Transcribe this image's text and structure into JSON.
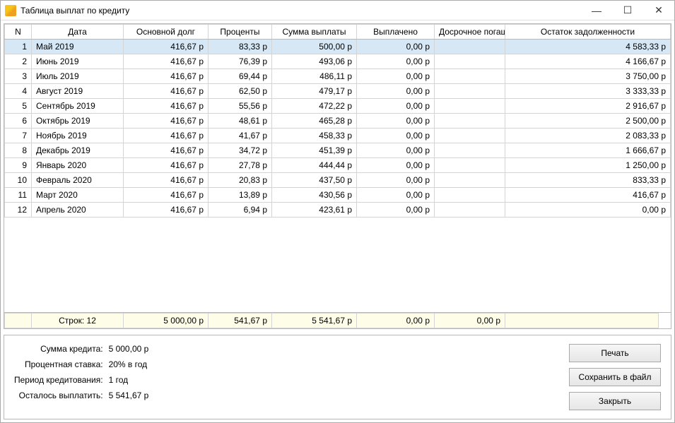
{
  "window": {
    "title": "Таблица выплат по кредиту"
  },
  "table": {
    "headers": {
      "n": "N",
      "date": "Дата",
      "principal": "Основной долг",
      "interest": "Проценты",
      "payment": "Сумма выплаты",
      "paid": "Выплачено",
      "early": "Досрочное погашение",
      "balance": "Остаток задолженности"
    },
    "rows": [
      {
        "n": "1",
        "date": "Май 2019",
        "principal": "416,67 р",
        "interest": "83,33 р",
        "payment": "500,00 р",
        "paid": "0,00 р",
        "early": "",
        "balance": "4 583,33 р"
      },
      {
        "n": "2",
        "date": "Июнь 2019",
        "principal": "416,67 р",
        "interest": "76,39 р",
        "payment": "493,06 р",
        "paid": "0,00 р",
        "early": "",
        "balance": "4 166,67 р"
      },
      {
        "n": "3",
        "date": "Июль 2019",
        "principal": "416,67 р",
        "interest": "69,44 р",
        "payment": "486,11 р",
        "paid": "0,00 р",
        "early": "",
        "balance": "3 750,00 р"
      },
      {
        "n": "4",
        "date": "Август 2019",
        "principal": "416,67 р",
        "interest": "62,50 р",
        "payment": "479,17 р",
        "paid": "0,00 р",
        "early": "",
        "balance": "3 333,33 р"
      },
      {
        "n": "5",
        "date": "Сентябрь 2019",
        "principal": "416,67 р",
        "interest": "55,56 р",
        "payment": "472,22 р",
        "paid": "0,00 р",
        "early": "",
        "balance": "2 916,67 р"
      },
      {
        "n": "6",
        "date": "Октябрь 2019",
        "principal": "416,67 р",
        "interest": "48,61 р",
        "payment": "465,28 р",
        "paid": "0,00 р",
        "early": "",
        "balance": "2 500,00 р"
      },
      {
        "n": "7",
        "date": "Ноябрь 2019",
        "principal": "416,67 р",
        "interest": "41,67 р",
        "payment": "458,33 р",
        "paid": "0,00 р",
        "early": "",
        "balance": "2 083,33 р"
      },
      {
        "n": "8",
        "date": "Декабрь 2019",
        "principal": "416,67 р",
        "interest": "34,72 р",
        "payment": "451,39 р",
        "paid": "0,00 р",
        "early": "",
        "balance": "1 666,67 р"
      },
      {
        "n": "9",
        "date": "Январь 2020",
        "principal": "416,67 р",
        "interest": "27,78 р",
        "payment": "444,44 р",
        "paid": "0,00 р",
        "early": "",
        "balance": "1 250,00 р"
      },
      {
        "n": "10",
        "date": "Февраль 2020",
        "principal": "416,67 р",
        "interest": "20,83 р",
        "payment": "437,50 р",
        "paid": "0,00 р",
        "early": "",
        "balance": "833,33 р"
      },
      {
        "n": "11",
        "date": "Март 2020",
        "principal": "416,67 р",
        "interest": "13,89 р",
        "payment": "430,56 р",
        "paid": "0,00 р",
        "early": "",
        "balance": "416,67 р"
      },
      {
        "n": "12",
        "date": "Апрель 2020",
        "principal": "416,67 р",
        "interest": "6,94 р",
        "payment": "423,61 р",
        "paid": "0,00 р",
        "early": "",
        "balance": "0,00 р"
      }
    ],
    "footer": {
      "rows_label": "Строк: 12",
      "principal_total": "5 000,00 р",
      "interest_total": "541,67 р",
      "payment_total": "5 541,67 р",
      "paid_total": "0,00 р",
      "early_total": "0,00 р",
      "balance_total": ""
    }
  },
  "summary": {
    "amount_label": "Сумма кредита:",
    "amount_value": "5 000,00 р",
    "rate_label": "Процентная ставка:",
    "rate_value": "20% в год",
    "period_label": "Период кредитования:",
    "period_value": "1 год",
    "remaining_label": "Осталось выплатить:",
    "remaining_value": "5 541,67 р"
  },
  "buttons": {
    "print": "Печать",
    "save": "Сохранить в файл",
    "close": "Закрыть"
  }
}
